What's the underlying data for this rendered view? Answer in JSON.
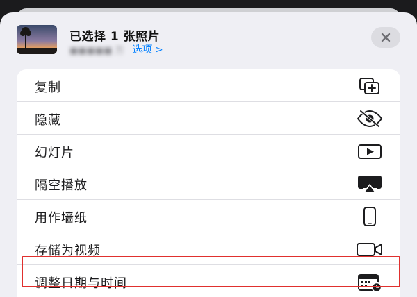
{
  "header": {
    "title": "已选择 1 张照片",
    "options_link": "选项 >",
    "thumbnail": "sunset-photo-thumbnail"
  },
  "close_icon": "close-icon",
  "menu": {
    "items": [
      {
        "label": "复制",
        "icon": "duplicate-icon"
      },
      {
        "label": "隐藏",
        "icon": "eye-slash-icon"
      },
      {
        "label": "幻灯片",
        "icon": "play-rectangle-icon"
      },
      {
        "label": "隔空播放",
        "icon": "airplay-icon"
      },
      {
        "label": "用作墙纸",
        "icon": "iphone-icon",
        "highlighted": true
      },
      {
        "label": "存储为视频",
        "icon": "video-camera-icon"
      },
      {
        "label": "调整日期与时间",
        "icon": "calendar-clock-icon"
      }
    ]
  },
  "colors": {
    "accent": "#0a84ff",
    "highlight_border": "#e0302e",
    "sheet_background": "#efeff4"
  }
}
